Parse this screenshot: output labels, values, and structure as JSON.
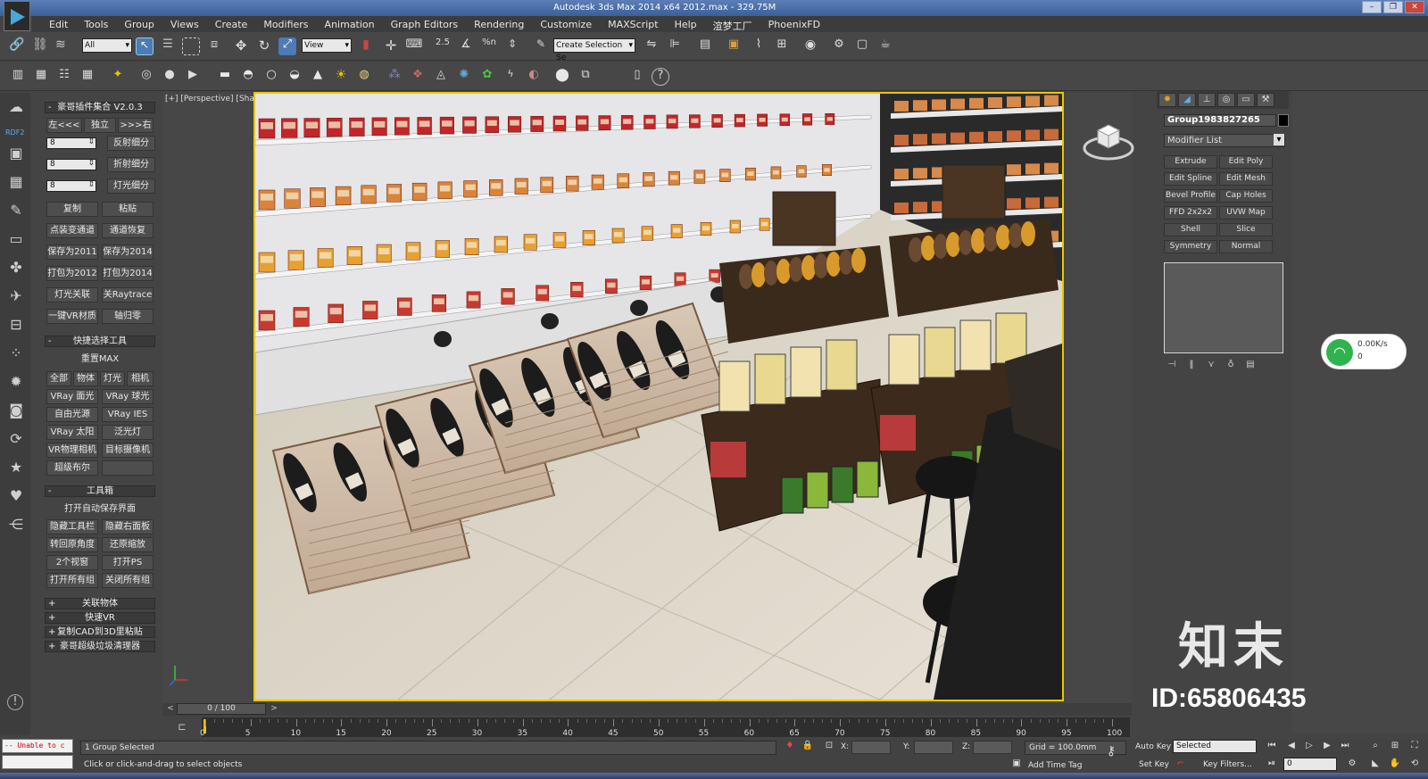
{
  "app": {
    "title": "Autodesk 3ds Max  2014 x64      2012.max - 329.75M"
  },
  "menu": [
    "Edit",
    "Tools",
    "Group",
    "Views",
    "Create",
    "Modifiers",
    "Animation",
    "Graph Editors",
    "Rendering",
    "Customize",
    "MAXScript",
    "Help",
    "渲梦工厂",
    "PhoenixFD"
  ],
  "toolbar": {
    "selection_filter": "All",
    "ref_coord": "View",
    "named_selection": "Create Selection Se",
    "snap_labels": [
      "2.5",
      "%n"
    ]
  },
  "left_icons": {
    "rdf_label": "RDF2"
  },
  "plugin": {
    "header": "豪哥插件集合 V2.0.3",
    "top_buttons": [
      "左<<<",
      "独立",
      ">>>右"
    ],
    "spinners": [
      {
        "value": "8",
        "label": "反射细分"
      },
      {
        "value": "8",
        "label": "折射细分"
      },
      {
        "value": "8",
        "label": "灯光细分"
      }
    ],
    "grid1": [
      "复制",
      "粘贴",
      "点装变通道",
      "通道恢复",
      "保存为2011",
      "保存为2014",
      "打包为2012",
      "打包为2014",
      "灯光关联",
      "关Raytrace",
      "一键VR材质",
      "轴归零"
    ],
    "quick_select_header": "快捷选择工具",
    "reset_max": "重置MAX",
    "select_row": [
      "全部",
      "物体",
      "灯光",
      "相机"
    ],
    "grid2": [
      "VRay 面光",
      "VRay 球光",
      "自由光源",
      "VRay IES",
      "VRay 太阳",
      "泛光灯",
      "VR物理相机",
      "目标摄像机",
      "超级布尔",
      ""
    ],
    "toolbox_header": "工具箱",
    "autosave": "打开自动保存界面",
    "grid3": [
      "隐藏工具栏",
      "隐藏右面板",
      "转回原角度",
      "还原缩放",
      "2个视窗",
      "打开PS",
      "打开所有组",
      "关闭所有组"
    ],
    "rollouts": [
      "关联物体",
      "快速VR",
      "复制CAD到3D里粘贴",
      "豪哥超级垃圾清理器"
    ]
  },
  "viewport": {
    "label": "[+] [Perspective] [Shaded]"
  },
  "command_panel": {
    "object_name": "Group1983827265",
    "modifier_list": "Modifier List",
    "modifier_buttons": [
      "Extrude",
      "Edit Poly",
      "Edit Spline",
      "Edit Mesh",
      "Bevel Profile",
      "Cap Holes",
      "FFD 2x2x2",
      "UVW Map",
      "Shell",
      "Slice",
      "Symmetry",
      "Normal"
    ]
  },
  "network_widget": {
    "speed": "0.00K/s",
    "count": "0"
  },
  "watermark": {
    "brand": "知末",
    "id": "ID:65806435"
  },
  "timeline": {
    "frame_display": "0 / 100",
    "ticks": [
      "0",
      "5",
      "10",
      "15",
      "20",
      "25",
      "30",
      "35",
      "40",
      "45",
      "50",
      "55",
      "60",
      "65",
      "70",
      "75",
      "80",
      "85",
      "90",
      "95",
      "100"
    ]
  },
  "status": {
    "maxscript_line1": "-- Unable to c",
    "selection_count": "1 Group Selected",
    "prompt": "Click or click-and-drag to select objects",
    "x_label": "X:",
    "y_label": "Y:",
    "z_label": "Z:",
    "grid": "Grid = 100.0mm",
    "add_time_tag": "Add Time Tag",
    "auto_key": "Auto Key",
    "set_key": "Set Key",
    "key_mode": "Selected",
    "key_filters": "Key Filters...",
    "current_frame": "0"
  },
  "colors": {
    "selection_highlight": "#e8c700",
    "accent_blue": "#4aa6d8",
    "wifi_green": "#2fb34f"
  }
}
